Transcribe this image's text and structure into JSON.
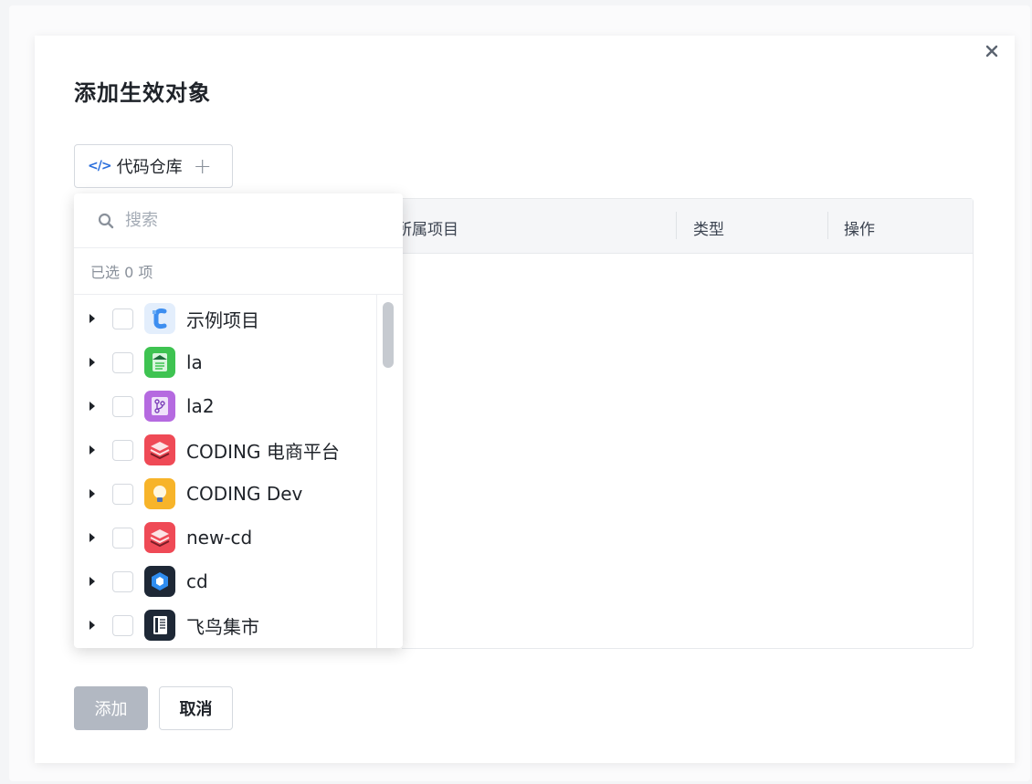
{
  "dialog": {
    "title": "添加生效对象",
    "close_icon": "close-icon"
  },
  "type_selector": {
    "icon": "code-icon",
    "icon_glyph": "</>",
    "label": "代码仓库",
    "plus_icon": "plus-icon",
    "plus_glyph": "+"
  },
  "table": {
    "columns": [
      "所属项目",
      "类型",
      "操作"
    ]
  },
  "dropdown": {
    "search_placeholder": "搜索",
    "selected_count": "已选 0 项",
    "items": [
      {
        "label": "示例项目",
        "icon": "coding-c-logo-icon",
        "color": "#dbe9fb"
      },
      {
        "label": "la",
        "icon": "document-icon",
        "color": "#3ec351"
      },
      {
        "label": "la2",
        "icon": "branch-icon",
        "color": "#b56ae0"
      },
      {
        "label": "CODING 电商平台",
        "icon": "layers-icon",
        "color": "#ef4a56"
      },
      {
        "label": "CODING Dev",
        "icon": "lightbulb-icon",
        "color": "#f7b42a"
      },
      {
        "label": "new-cd",
        "icon": "layers-icon",
        "color": "#ef4a56"
      },
      {
        "label": "cd",
        "icon": "cube-icon",
        "color": "#1e2836"
      },
      {
        "label": "飞鸟集市",
        "icon": "notebook-icon",
        "color": "#1e2836"
      }
    ]
  },
  "footer": {
    "add_label": "添加",
    "cancel_label": "取消"
  }
}
